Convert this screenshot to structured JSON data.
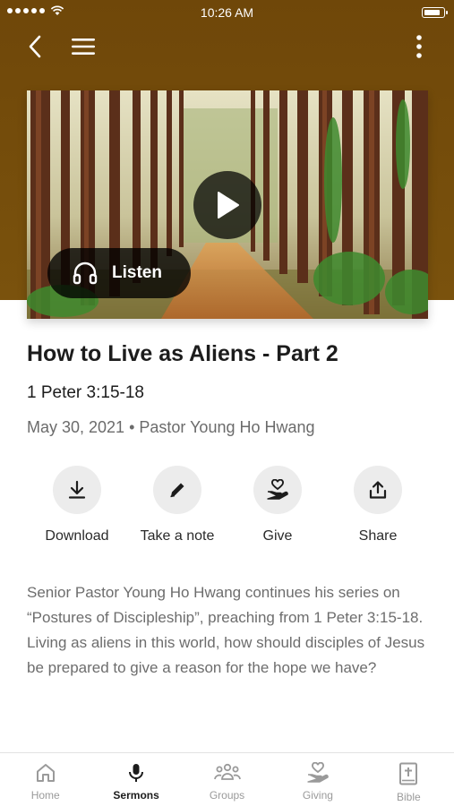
{
  "status_bar": {
    "time": "10:26 AM",
    "battery_level": 0.85
  },
  "header": {
    "back_icon": "chevron-left-icon",
    "menu_icon": "hamburger-menu-icon",
    "more_icon": "vertical-ellipsis-icon"
  },
  "hero": {
    "play_icon": "play-icon",
    "listen_label": "Listen",
    "listen_icon": "headphones-icon"
  },
  "sermon": {
    "title": "How to Live as Aliens - Part 2",
    "scripture": "1 Peter 3:15-18",
    "meta": "May 30, 2021 • Pastor Young Ho Hwang",
    "description": "Senior Pastor Young Ho Hwang continues his series on “Postures of Discipleship”, preaching from 1 Peter 3:15-18. Living as aliens in this world, how should disciples of Jesus be prepared to give a reason for the hope we have?"
  },
  "actions": [
    {
      "label": "Download",
      "icon": "download-icon"
    },
    {
      "label": "Take a note",
      "icon": "pencil-icon"
    },
    {
      "label": "Give",
      "icon": "giving-hand-heart-icon"
    },
    {
      "label": "Share",
      "icon": "share-icon"
    }
  ],
  "tabs": [
    {
      "label": "Home",
      "icon": "home-icon",
      "active": false
    },
    {
      "label": "Sermons",
      "icon": "microphone-icon",
      "active": true
    },
    {
      "label": "Groups",
      "icon": "groups-icon",
      "active": false
    },
    {
      "label": "Giving",
      "icon": "giving-hand-heart-icon",
      "active": false
    },
    {
      "label": "Bible",
      "icon": "bible-icon",
      "active": false
    }
  ],
  "colors": {
    "header_brown": "#74500c",
    "text_primary": "#1c1c1c",
    "text_secondary": "#6d6d6d",
    "tab_inactive": "#9a9a9a"
  }
}
